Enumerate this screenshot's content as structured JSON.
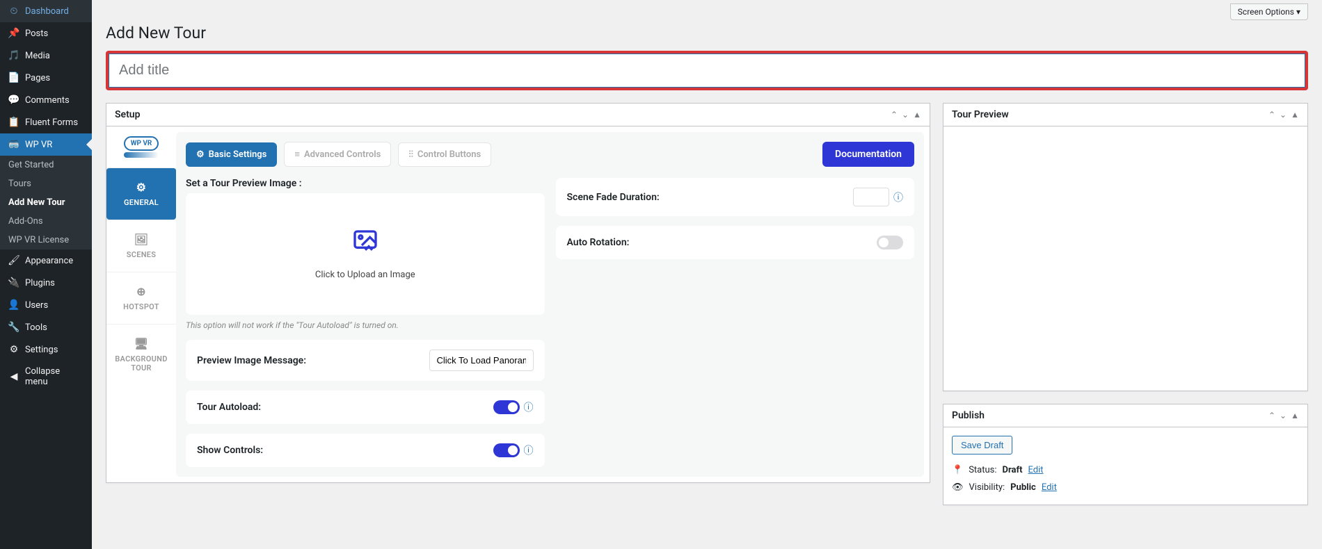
{
  "sidebar": {
    "items": [
      {
        "label": "Dashboard"
      },
      {
        "label": "Posts"
      },
      {
        "label": "Media"
      },
      {
        "label": "Pages"
      },
      {
        "label": "Comments"
      },
      {
        "label": "Fluent Forms"
      },
      {
        "label": "WP VR"
      },
      {
        "label": "Appearance"
      },
      {
        "label": "Plugins"
      },
      {
        "label": "Users"
      },
      {
        "label": "Tools"
      },
      {
        "label": "Settings"
      },
      {
        "label": "Collapse menu"
      }
    ],
    "sub": [
      {
        "label": "Get Started"
      },
      {
        "label": "Tours"
      },
      {
        "label": "Add New Tour"
      },
      {
        "label": "Add-Ons"
      },
      {
        "label": "WP VR License"
      }
    ]
  },
  "screenOptions": "Screen Options ▾",
  "pageTitle": "Add New Tour",
  "titlePlaceholder": "Add title",
  "setup": {
    "header": "Setup",
    "logo": "WP VR",
    "vtabs": {
      "general": "GENERAL",
      "scenes": "SCENES",
      "hotspot": "HOTSPOT",
      "background": "BACKGROUND TOUR"
    },
    "htabs": {
      "basic": "Basic Settings",
      "advanced": "Advanced Controls",
      "control": "Control Buttons"
    },
    "doc": "Documentation",
    "previewImageLabel": "Set a Tour Preview Image :",
    "uploadText": "Click to Upload an Image",
    "uploadHint": "This option will not work if the \"Tour Autoload\" is turned on.",
    "previewMsgLabel": "Preview Image Message:",
    "previewMsgValue": "Click To Load Panoram",
    "autoloadLabel": "Tour Autoload:",
    "showControlsLabel": "Show Controls:",
    "fadeLabel": "Scene Fade Duration:",
    "rotationLabel": "Auto Rotation:"
  },
  "preview": {
    "header": "Tour Preview"
  },
  "publish": {
    "header": "Publish",
    "saveDraft": "Save Draft",
    "statusLabel": "Status:",
    "statusValue": "Draft",
    "visibilityLabel": "Visibility:",
    "visibilityValue": "Public",
    "edit": "Edit"
  }
}
